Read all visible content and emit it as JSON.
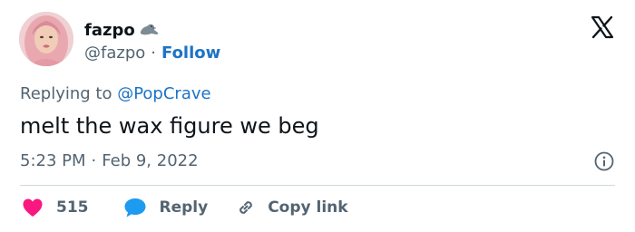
{
  "author": {
    "display_name": "fazpo",
    "handle": "@fazpo",
    "separator": "·",
    "follow_label": "Follow",
    "badge_icon": "seal-emoji"
  },
  "tweet": {
    "replying_prefix": "Replying to ",
    "replying_to": "@PopCrave",
    "text": "melt the wax figure we beg",
    "time": "5:23 PM",
    "date_separator": "·",
    "date": "Feb 9, 2022"
  },
  "actions": {
    "like_count": "515",
    "reply_label": "Reply",
    "copy_label": "Copy link"
  },
  "colors": {
    "accent": "#1d73c6",
    "like": "#f91880",
    "muted_text": "#536471",
    "primary_text": "#0f1419"
  }
}
